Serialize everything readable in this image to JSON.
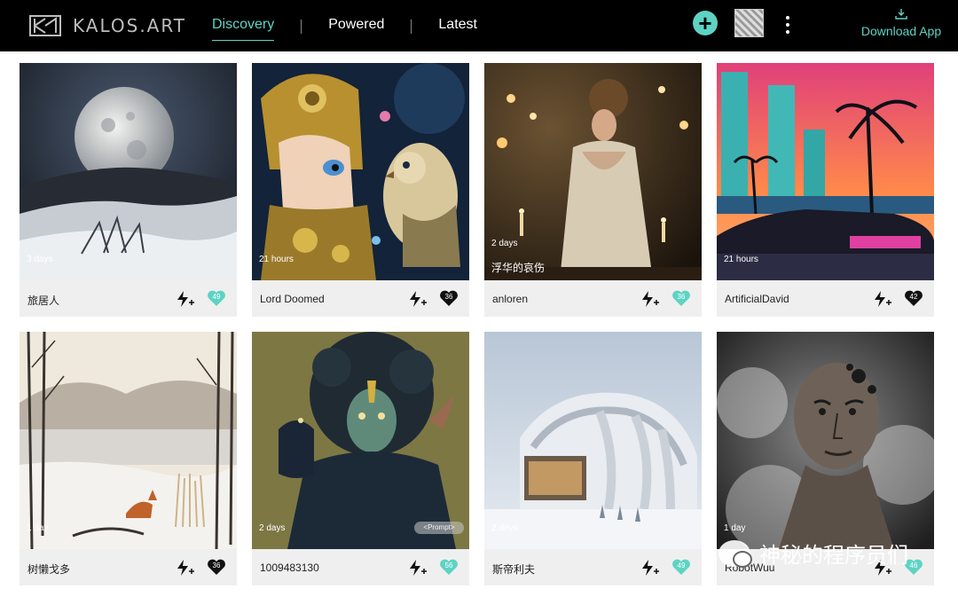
{
  "app": {
    "name": "KALOS.ART"
  },
  "nav": {
    "items": [
      "Discovery",
      "Powered",
      "Latest"
    ],
    "active": "Discovery"
  },
  "header": {
    "add_label": "+",
    "download_label": "Download App"
  },
  "cards": [
    {
      "user": "旅居人",
      "age": "3 days",
      "likes": "49",
      "heart_style": "teal",
      "art": "moon-landscape"
    },
    {
      "user": "Lord Doomed",
      "age": "21 hours",
      "likes": "36",
      "heart_style": "dark",
      "art": "armored-girl-with-owl"
    },
    {
      "user": "anloren",
      "age": "2 days",
      "caption": "浮华的哀伤",
      "likes": "36",
      "heart_style": "teal",
      "art": "woman-in-dress-with-candles"
    },
    {
      "user": "ArtificialDavid",
      "age": "21 hours",
      "likes": "42",
      "heart_style": "dark",
      "art": "retro-car-palm-trees"
    },
    {
      "user": "树懒戈多",
      "age": "1 day",
      "likes": "36",
      "heart_style": "dark",
      "art": "winter-fox-lake"
    },
    {
      "user": "1009483130",
      "age": "2 days",
      "prompt_label": "<Prompt>",
      "likes": "56",
      "heart_style": "teal",
      "art": "dark-fantasy-figure"
    },
    {
      "user": "斯帝利夫",
      "age": "2 days",
      "likes": "49",
      "heart_style": "teal",
      "art": "organic-architecture-snow"
    },
    {
      "user": "RobotWuu",
      "age": "1 day",
      "likes": "46",
      "heart_style": "teal",
      "art": "smoke-man-portrait"
    }
  ],
  "watermark": {
    "text": "神秘的程序员们"
  },
  "colors": {
    "accent": "#5ed3c4",
    "topbar": "#000000",
    "card_footer": "#efefef"
  }
}
